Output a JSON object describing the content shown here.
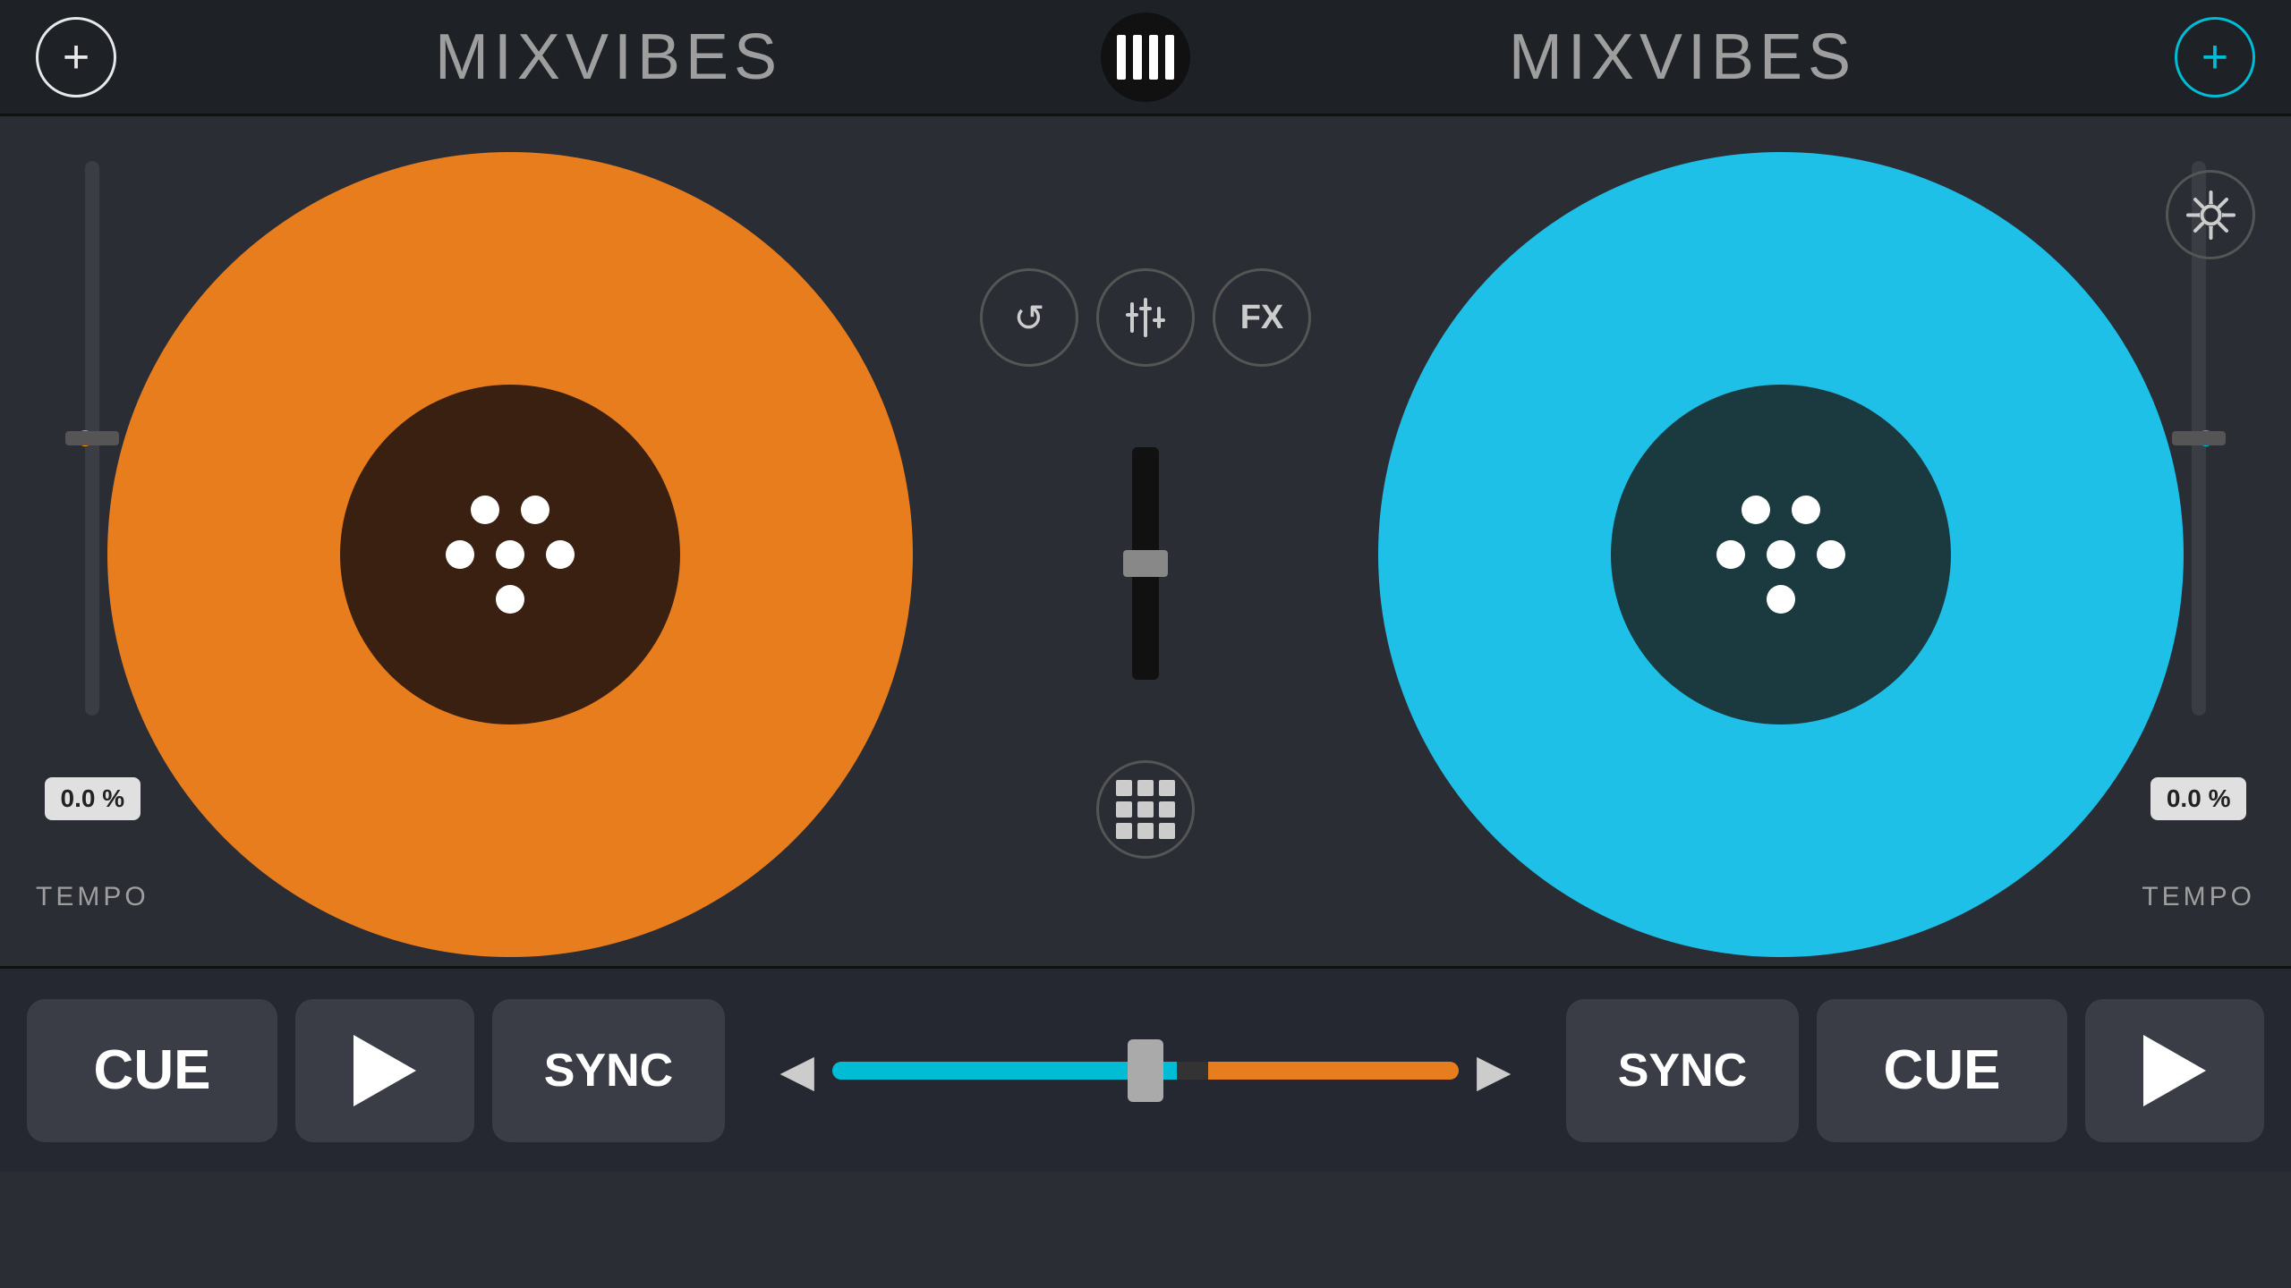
{
  "app": {
    "title": "MIXVIBES"
  },
  "header": {
    "add_left": "+",
    "brand_left": "MIXVIBES",
    "brand_right": "MIXVIBES",
    "add_right": "+"
  },
  "controls": {
    "loop_label": "↺",
    "eq_label": "⊤",
    "fx_label": "FX",
    "grid_label": "⊞",
    "settings_label": "⚙"
  },
  "deck_left": {
    "color": "#e87d1e",
    "center_color": "#3a2010",
    "tempo_value": "0.0 %",
    "tempo_label": "TEMPO"
  },
  "deck_right": {
    "color": "#1ec0e8",
    "center_color": "#1a3a40",
    "tempo_value": "0.0 %",
    "tempo_label": "TEMPO"
  },
  "transport_left": {
    "cue_label": "CUE",
    "play_label": "▶",
    "sync_label": "SYNC"
  },
  "transport_right": {
    "sync_label": "SYNC",
    "cue_label": "CUE",
    "play_label": "▶"
  },
  "crossfader": {
    "arrow_left": "◀",
    "arrow_right": "▶"
  }
}
